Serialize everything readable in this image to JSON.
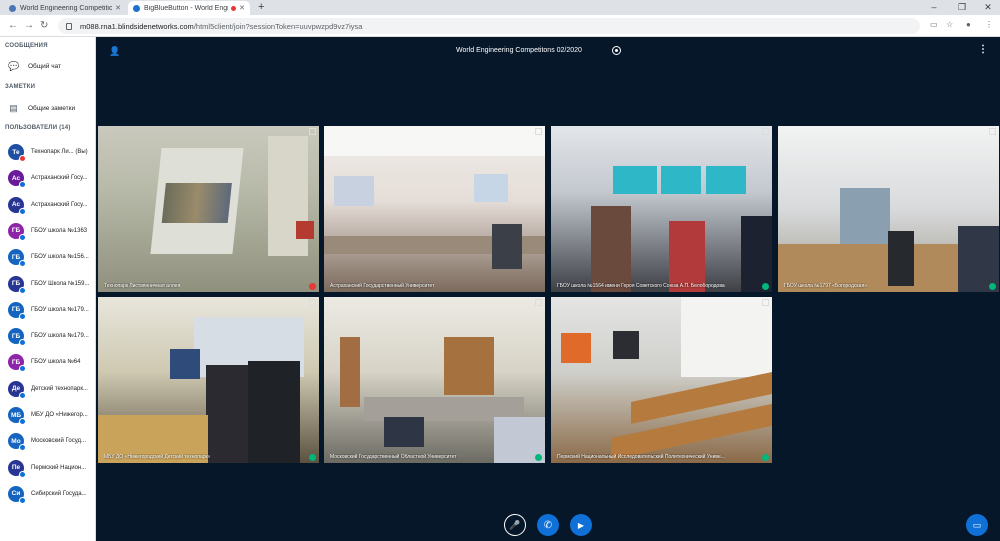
{
  "browser": {
    "tabs": [
      {
        "title": "World Engineering Competitions",
        "active": false
      },
      {
        "title": "BigBlueButton - World Engi",
        "active": true
      }
    ],
    "new_tab": "+",
    "window_controls": [
      "–",
      "❐",
      "✕"
    ],
    "url_host": "m088.rna1.blindsidenetworks.com",
    "url_path": "/html5client/join?sessionToken=uuvpwzpd9vz7iysa"
  },
  "sidebar": {
    "messages_title": "СООБЩЕНИЯ",
    "public_chat": "Общий чат",
    "notes_title": "ЗАМЕТКИ",
    "shared_notes": "Общие заметки",
    "users_title": "ПОЛЬЗОВАТЕЛИ (14)",
    "users": [
      {
        "initials": "Те",
        "name": "Технопарк Ли...  (Вы)",
        "color": "#1e4fa3"
      },
      {
        "initials": "Ас",
        "name": "Астраханский Госу...",
        "color": "#6a1b9a"
      },
      {
        "initials": "Ас",
        "name": "Астраханский Госу...",
        "color": "#283593"
      },
      {
        "initials": "ГБ",
        "name": "ГБОУ школа №1363",
        "color": "#8e24aa"
      },
      {
        "initials": "ГБ",
        "name": "ГБОУ школа №156...",
        "color": "#1565c0"
      },
      {
        "initials": "ГБ",
        "name": "ГБОУ Школа №159...",
        "color": "#283593"
      },
      {
        "initials": "ГБ",
        "name": "ГБОУ школа №179...",
        "color": "#1565c0"
      },
      {
        "initials": "ГБ",
        "name": "ГБОУ школа №179...",
        "color": "#1565c0"
      },
      {
        "initials": "ГБ",
        "name": "ГБОУ школа №64",
        "color": "#8e24aa"
      },
      {
        "initials": "Де",
        "name": "Детский технопарк...",
        "color": "#283593"
      },
      {
        "initials": "МБ",
        "name": "МБУ ДО «Нижегор...",
        "color": "#1565c0"
      },
      {
        "initials": "Мо",
        "name": "Московский Госуд...",
        "color": "#1565c0"
      },
      {
        "initials": "Пе",
        "name": "Пермский Национ...",
        "color": "#283593"
      },
      {
        "initials": "Си",
        "name": "Сибирский Госуда...",
        "color": "#1565c0"
      }
    ]
  },
  "meeting": {
    "title": "World Engineering Competitons 02/2020"
  },
  "videos": [
    {
      "label": "Технопарк Листвянничная аллея",
      "mic": "off"
    },
    {
      "label": "Астраханский Государственный Университет",
      "mic": "none"
    },
    {
      "label": "ГБОУ школа №1564 имени Героя Советского Союза А.П. Белобородова",
      "mic": "on"
    },
    {
      "label": "ГБОУ школа №1797 «Богородская»",
      "mic": "on"
    },
    {
      "label": "МБУ ДО «Нижегородский Детский технопарк»",
      "mic": "on"
    },
    {
      "label": "Московский Государственный Областной Университет",
      "mic": "on"
    },
    {
      "label": "Пермский Национальный Исследовательский Политехнический Униве...",
      "mic": "on"
    }
  ],
  "controls": {
    "mute_icon": "🎤",
    "phone_icon": "✆",
    "camera_icon": "▶",
    "present_icon": "▭"
  },
  "colors": {
    "bbb_blue": "#0f70d7",
    "background": "#06172a",
    "mic_on": "#00b67a",
    "mic_off": "#e53935"
  }
}
